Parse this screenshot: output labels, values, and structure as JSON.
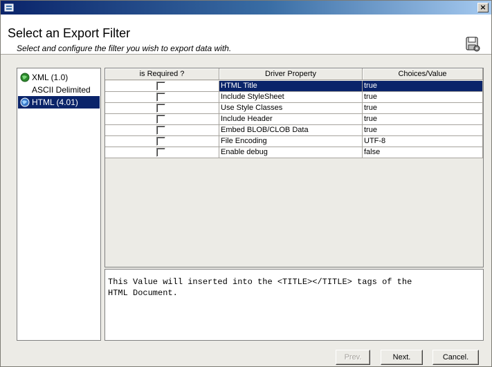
{
  "window": {
    "close_glyph": "×"
  },
  "header": {
    "title": "Select an Export Filter",
    "subtitle": "Select and configure the filter you wish to export data with."
  },
  "filters": [
    {
      "label": "XML (1.0)",
      "icon": "globe-icon",
      "selected": false
    },
    {
      "label": "ASCII Delimited",
      "icon": "",
      "selected": false
    },
    {
      "label": "HTML (4.01)",
      "icon": "globe-icon",
      "selected": true
    }
  ],
  "grid": {
    "columns": [
      "is Required ?",
      "Driver Property",
      "Choices/Value"
    ],
    "rows": [
      {
        "required": false,
        "property": "HTML Title",
        "value": "true",
        "selected": true
      },
      {
        "required": false,
        "property": "Include StyleSheet",
        "value": "true",
        "selected": false
      },
      {
        "required": false,
        "property": "Use Style Classes",
        "value": "true",
        "selected": false
      },
      {
        "required": false,
        "property": "Include Header",
        "value": "true",
        "selected": false
      },
      {
        "required": false,
        "property": "Embed BLOB/CLOB Data",
        "value": "true",
        "selected": false
      },
      {
        "required": false,
        "property": "File Encoding",
        "value": "UTF-8",
        "selected": false
      },
      {
        "required": false,
        "property": "Enable debug",
        "value": "false",
        "selected": false
      }
    ]
  },
  "description": "This Value will inserted into the <TITLE></TITLE> tags of the\nHTML Document.",
  "buttons": {
    "prev": "Prev.",
    "next": "Next.",
    "cancel": "Cancel."
  },
  "colors": {
    "selection": "#0a246a",
    "titlebar_start": "#0a246a",
    "titlebar_end": "#a6caf0"
  }
}
